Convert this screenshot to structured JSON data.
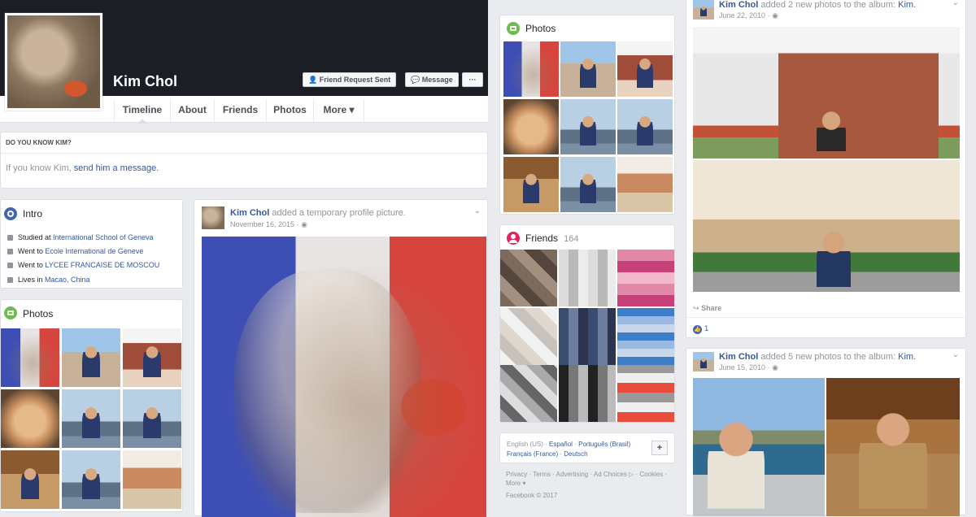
{
  "profile": {
    "name": "Kim Chol",
    "friend_request_label": "Friend Request Sent",
    "message_label": "Message",
    "more_label": "···"
  },
  "tabs": [
    "Timeline",
    "About",
    "Friends",
    "Photos",
    "More ▾"
  ],
  "know": {
    "title": "DO YOU KNOW KIM?",
    "text": "If you know Kim,",
    "link": "send him a message."
  },
  "intro": {
    "title": "Intro",
    "rows": [
      {
        "prefix": "Studied at ",
        "link": "International School of Geneva"
      },
      {
        "prefix": "Went to ",
        "link": "Ecole International de Geneve"
      },
      {
        "prefix": "Went to ",
        "link": "LYCEE FRANCAISE DE MOSCOU"
      },
      {
        "prefix": "Lives in ",
        "link": "Macao, China"
      }
    ]
  },
  "photos_title": "Photos",
  "friends": {
    "title": "Friends",
    "count": "164"
  },
  "post1": {
    "author": "Kim Chol",
    "action": "added a temporary profile picture.",
    "date": "November 16, 2015"
  },
  "post2": {
    "author": "Kim Chol",
    "action": "added 2 new photos to the album:",
    "album": "Kim.",
    "date": "June 22, 2010",
    "share_label": "Share",
    "likes": "1"
  },
  "post3": {
    "author": "Kim Chol",
    "action": "added 5 new photos to the album:",
    "album": "Kim.",
    "date": "June 15, 2010"
  },
  "footer": {
    "lang_current": "English (US)",
    "langs": [
      "Español",
      "Português (Brasil)",
      "Français (France)",
      "Deutsch"
    ],
    "lang_sep": "·",
    "plus": "+",
    "links": [
      "Privacy",
      "Terms",
      "Advertising",
      "Ad Choices ▷",
      "Cookies",
      "More ▾"
    ],
    "copyright": "Facebook © 2017"
  },
  "colors": {
    "cover": "#1c1e26",
    "link": "#365899",
    "accent": "#4267b2"
  }
}
